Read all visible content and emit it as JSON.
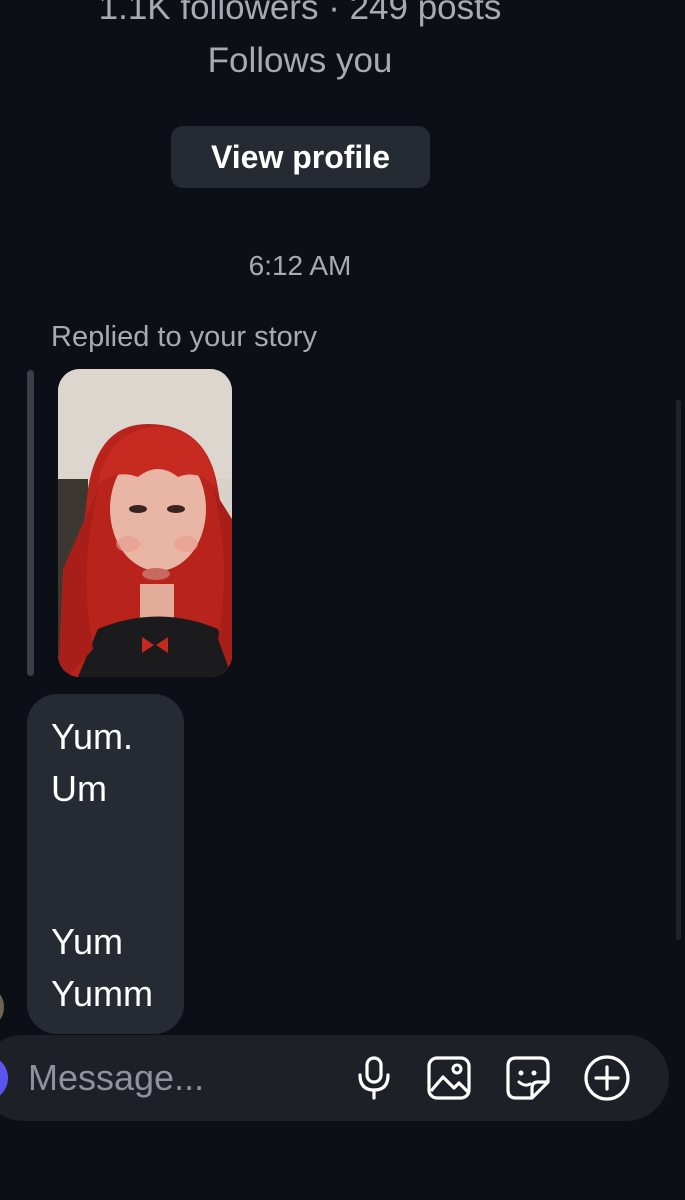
{
  "profile": {
    "stats": "1.1K followers · 249 posts",
    "follows_you": "Follows you",
    "view_profile_label": "View profile"
  },
  "thread": {
    "timestamp": "6:12 AM",
    "replied_label": "Replied to your story",
    "message_lines": [
      "Yum.",
      "Um",
      "Yum",
      "Yumm"
    ]
  },
  "composer": {
    "placeholder": "Message..."
  },
  "icons": {
    "microphone": "microphone-icon",
    "gallery": "gallery-icon",
    "sticker": "sticker-icon",
    "plus": "plus-circle-icon"
  },
  "colors": {
    "background": "#0c1016",
    "bubble": "#262b33",
    "secondary_text": "#a6aab1",
    "camera_accent": "#5b55f0"
  }
}
